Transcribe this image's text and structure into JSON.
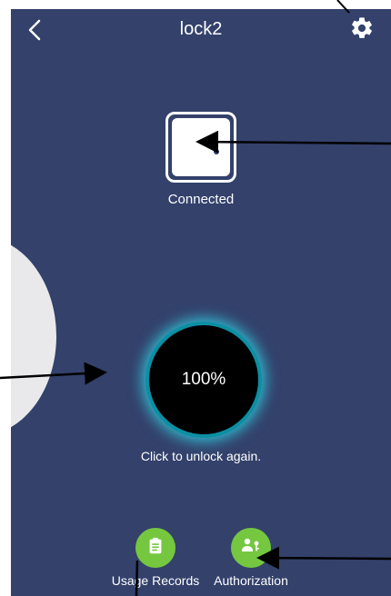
{
  "header": {
    "title": "lock2",
    "back_icon": "chevron-left-icon",
    "settings_icon": "gear-icon"
  },
  "lock": {
    "status": "Connected",
    "icon": "lock-device-icon"
  },
  "unlock": {
    "progress_text": "100%",
    "progress_value": 1.0,
    "hint": "Click to unlock again."
  },
  "actions": [
    {
      "label": "Usage Records",
      "icon": "clipboard-icon"
    },
    {
      "label": "Authorization",
      "icon": "user-key-icon"
    }
  ],
  "theme": {
    "background": "#33416b",
    "accent": "#75c73f",
    "glow": "#31c7db"
  }
}
